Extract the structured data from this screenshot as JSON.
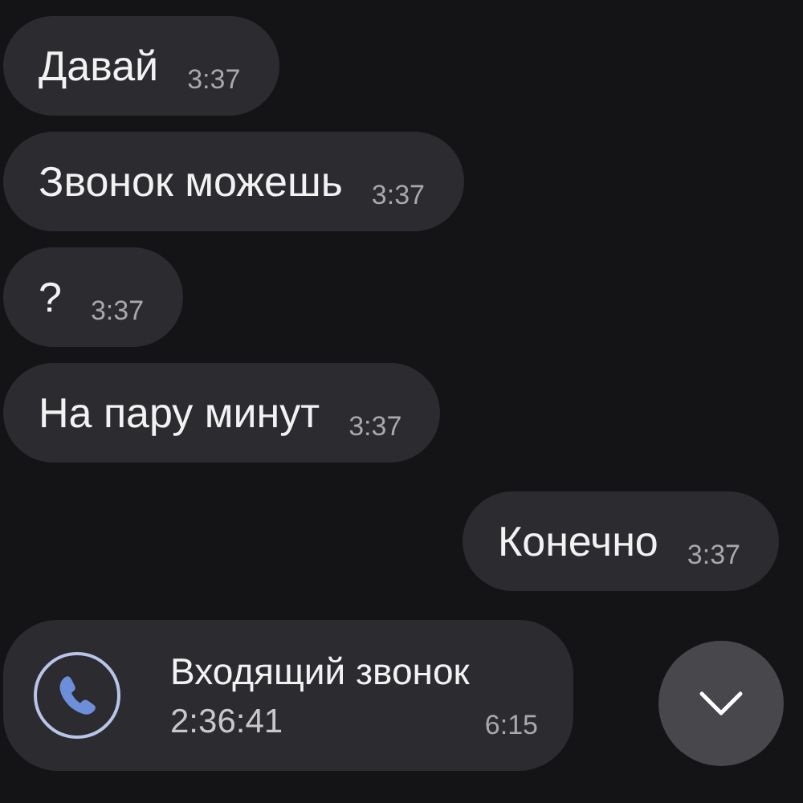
{
  "messages": [
    {
      "kind": "text",
      "outgoing": false,
      "text": "Давай",
      "time": "3:37"
    },
    {
      "kind": "text",
      "outgoing": false,
      "text": "Звонок можешь",
      "time": "3:37"
    },
    {
      "kind": "text",
      "outgoing": false,
      "text": "?",
      "time": "3:37"
    },
    {
      "kind": "text",
      "outgoing": false,
      "text": "На пару минут",
      "time": "3:37"
    },
    {
      "kind": "text",
      "outgoing": true,
      "text": "Конечно",
      "time": "3:37"
    },
    {
      "kind": "call",
      "outgoing": false,
      "title": "Входящий звонок",
      "duration": "2:36:41",
      "time": "6:15"
    }
  ]
}
